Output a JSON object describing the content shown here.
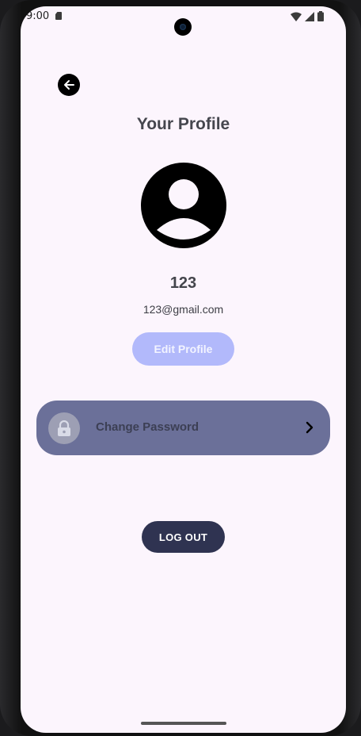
{
  "status_bar": {
    "time": "9:00",
    "icons": [
      "sim-card-icon",
      "wifi-icon",
      "signal-icon",
      "battery-icon"
    ]
  },
  "header": {
    "back_icon": "arrow-back-icon",
    "title": "Your Profile"
  },
  "profile": {
    "avatar_icon": "account-circle-icon",
    "name": "123",
    "email": "123@gmail.com",
    "edit_label": "Edit Profile"
  },
  "settings": {
    "change_password": {
      "icon": "lock-icon",
      "label": "Change Password",
      "chevron_icon": "chevron-right-icon"
    }
  },
  "actions": {
    "logout_label": "LOG OUT"
  },
  "colors": {
    "background": "#fcf5fd",
    "edit_button": "#b2b9fb",
    "password_row": "#6b7099",
    "logout_button": "#2f3351",
    "title_text": "#45464e"
  }
}
